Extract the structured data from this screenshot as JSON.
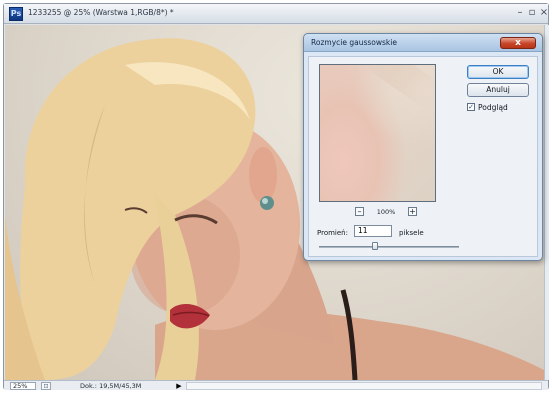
{
  "window": {
    "title": "1233255 @ 25% (Warstwa 1,RGB/8*) *",
    "app_icon": "Ps",
    "controls": {
      "minimize": "–",
      "maximize": "▫",
      "close": "×"
    }
  },
  "status_bar": {
    "zoom": "25%",
    "doc_size": "Dok.: 19,5M/45,3M",
    "menu_arrow": "▶"
  },
  "dialog": {
    "title": "Rozmycie gaussowskie",
    "close_glyph": "x",
    "ok_label": "OK",
    "cancel_label": "Anuluj",
    "preview_label": "Podgląd",
    "preview_checked": true,
    "check_glyph": "✓",
    "zoom_percent": "100%",
    "zoom_out_glyph": "–",
    "zoom_in_glyph": "+",
    "radius_label": "Promień:",
    "radius_value": "11",
    "radius_unit": "piksele",
    "radius_slider_fraction": 0.4
  },
  "colors": {
    "dialog_background": "#dbe7f4",
    "close_button": "#c7452a",
    "window_chrome": "#dfe3e8"
  }
}
